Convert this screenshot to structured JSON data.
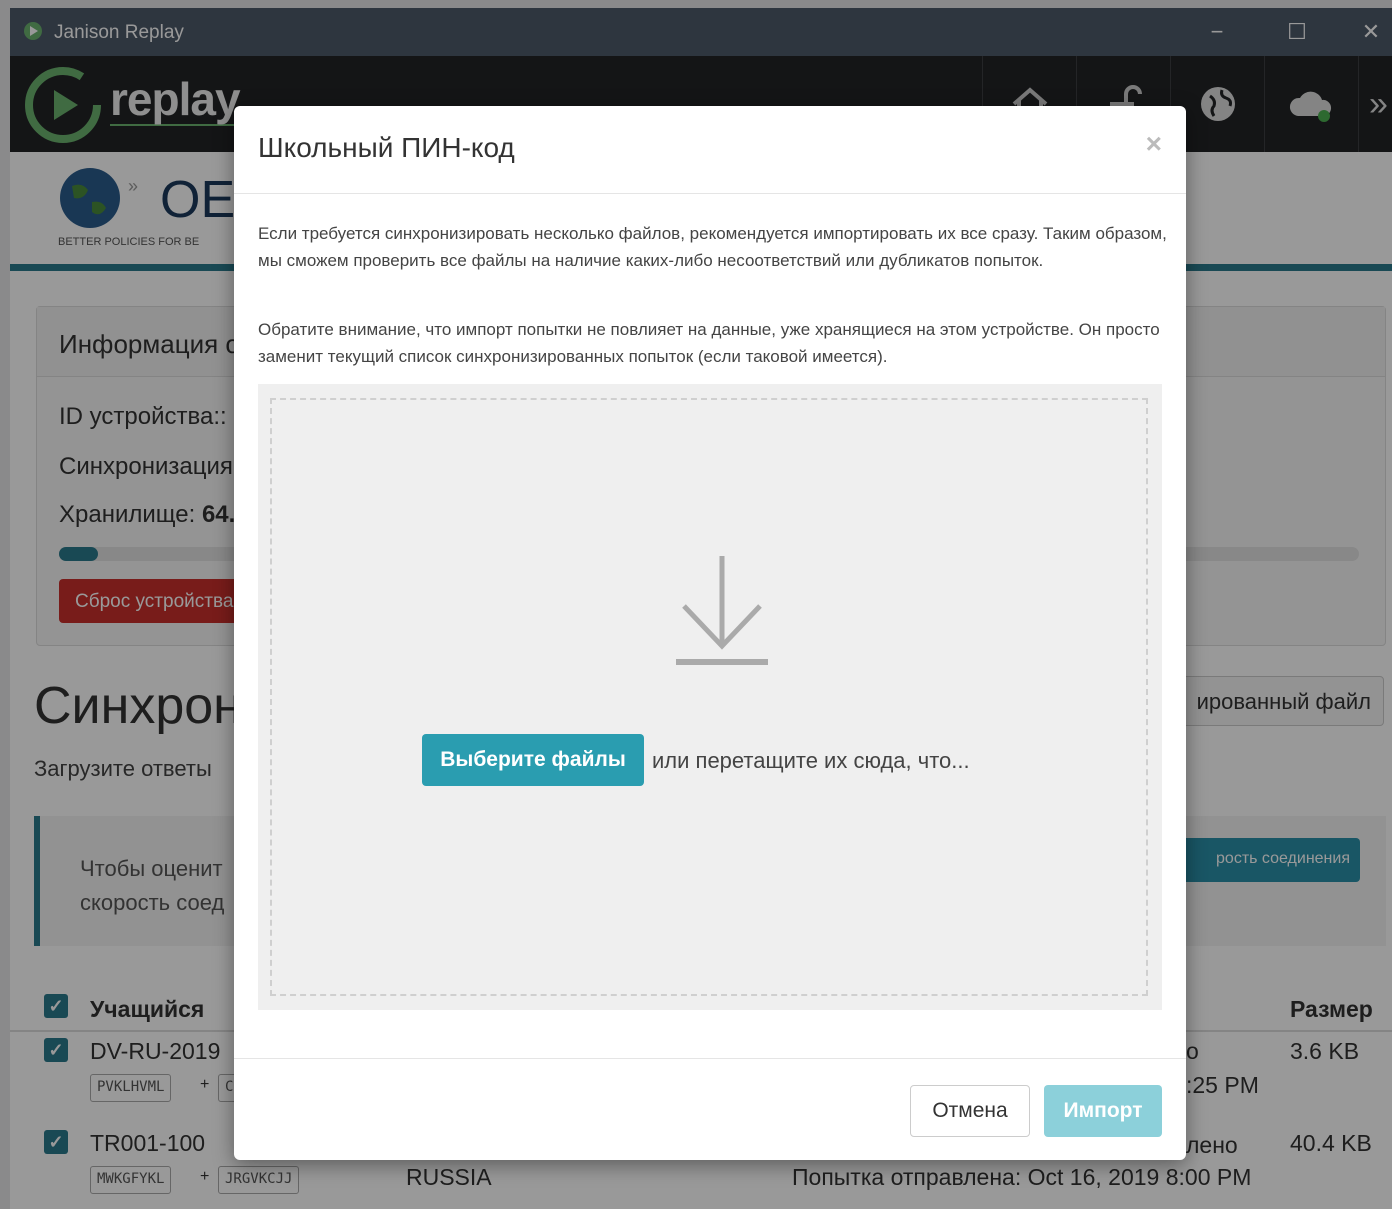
{
  "window": {
    "title": "Janison Replay",
    "minimize": "−",
    "maximize": "☐",
    "close": "✕"
  },
  "header": {
    "logo_text": "replay",
    "nav_more": "»"
  },
  "background": {
    "oecd_text": "OE",
    "oecd_tagline": "BETTER POLICIES FOR BE",
    "info_title": "Информация о",
    "device_id_label": "ID устройства::",
    "sync_label": "Синхронизация",
    "storage_label": "Хранилище:",
    "storage_value": "64.",
    "storage_progress": 0.03,
    "reset_button": "Сброс устройства",
    "sync_title": "Синхрон",
    "sync_subtitle": "Загрузите ответы",
    "file_button": "ированный файл",
    "speed_text_line1": "Чтобы оценит",
    "speed_text_line2": "скорость соед",
    "speed_button": "рость соединения",
    "table": {
      "col_student": "Учащийся",
      "col_size": "Размер",
      "rows": [
        {
          "student": "DV-RU-2019",
          "tag1": "PVKLHVML",
          "plus": "+",
          "tag2": "C",
          "status": "о",
          "time": ":25 PM",
          "size": "3.6 KB"
        },
        {
          "student": "TR001-100",
          "tag1": "MWKGFYKL",
          "plus": "+",
          "tag2": "JRGVKCJJ",
          "country": "RUSSIA",
          "status": "лено",
          "time": "Попытка отправлена: Oct 16, 2019 8:00 PM",
          "size": "40.4 KB"
        }
      ]
    }
  },
  "modal": {
    "title": "Школьный ПИН-код",
    "close": "×",
    "paragraph1": "Если требуется синхронизировать несколько файлов, рекомендуется импортировать их все сразу. Таким образом, мы сможем проверить все файлы на наличие каких-либо несоответствий или дубликатов попыток.",
    "paragraph2": "Обратите внимание, что импорт попытки не повлияет на данные, уже хранящиеся на этом устройстве. Он просто заменит текущий список синхронизированных попыток (если таковой имеется).",
    "choose_button": "Выберите файлы",
    "drop_hint": "или перетащите их сюда, что...",
    "cancel_button": "Отмена",
    "import_button": "Импорт"
  },
  "colors": {
    "titlebar": "#4e5a6a",
    "header": "#222426",
    "accent": "#2a9db0",
    "danger": "#c9302c"
  }
}
